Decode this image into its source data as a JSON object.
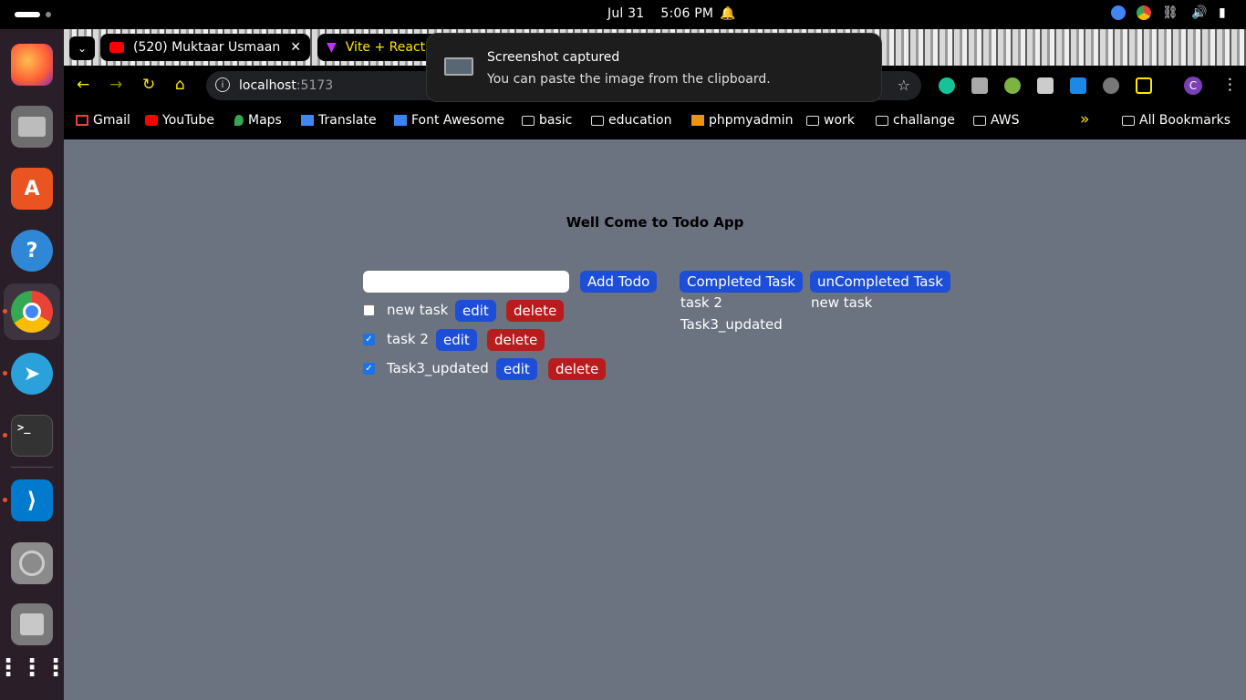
{
  "system": {
    "date": "Jul 31",
    "time": "5:06 PM"
  },
  "browser": {
    "tabs": [
      {
        "title": "(520) Muktaar Usmaan"
      },
      {
        "title": "Vite + React"
      }
    ],
    "url_host": "localhost",
    "url_port": ":5173",
    "profile_initial": "C",
    "bookmarks": [
      "Gmail",
      "YouTube",
      "Maps",
      "Translate",
      "Font Awesome",
      "basic",
      "education",
      "phpmyadmin",
      "work",
      "challange",
      "AWS"
    ],
    "more_bookmarks": "»",
    "all_bookmarks": "All Bookmarks"
  },
  "notification": {
    "title": "Screenshot captured",
    "message": "You can paste the image from the clipboard."
  },
  "app": {
    "title": "Well Come to Todo App",
    "input_value": "",
    "add_label": "Add Todo",
    "edit_label": "edit",
    "delete_label": "delete",
    "todos": [
      {
        "text": "new task",
        "done": false
      },
      {
        "text": "task 2",
        "done": true
      },
      {
        "text": "Task3_updated",
        "done": true
      }
    ],
    "completed_label": "Completed Task",
    "uncompleted_label": "unCompleted Task",
    "completed_list": [
      "task 2",
      "Task3_updated"
    ],
    "uncompleted_list": [
      "new task"
    ]
  }
}
